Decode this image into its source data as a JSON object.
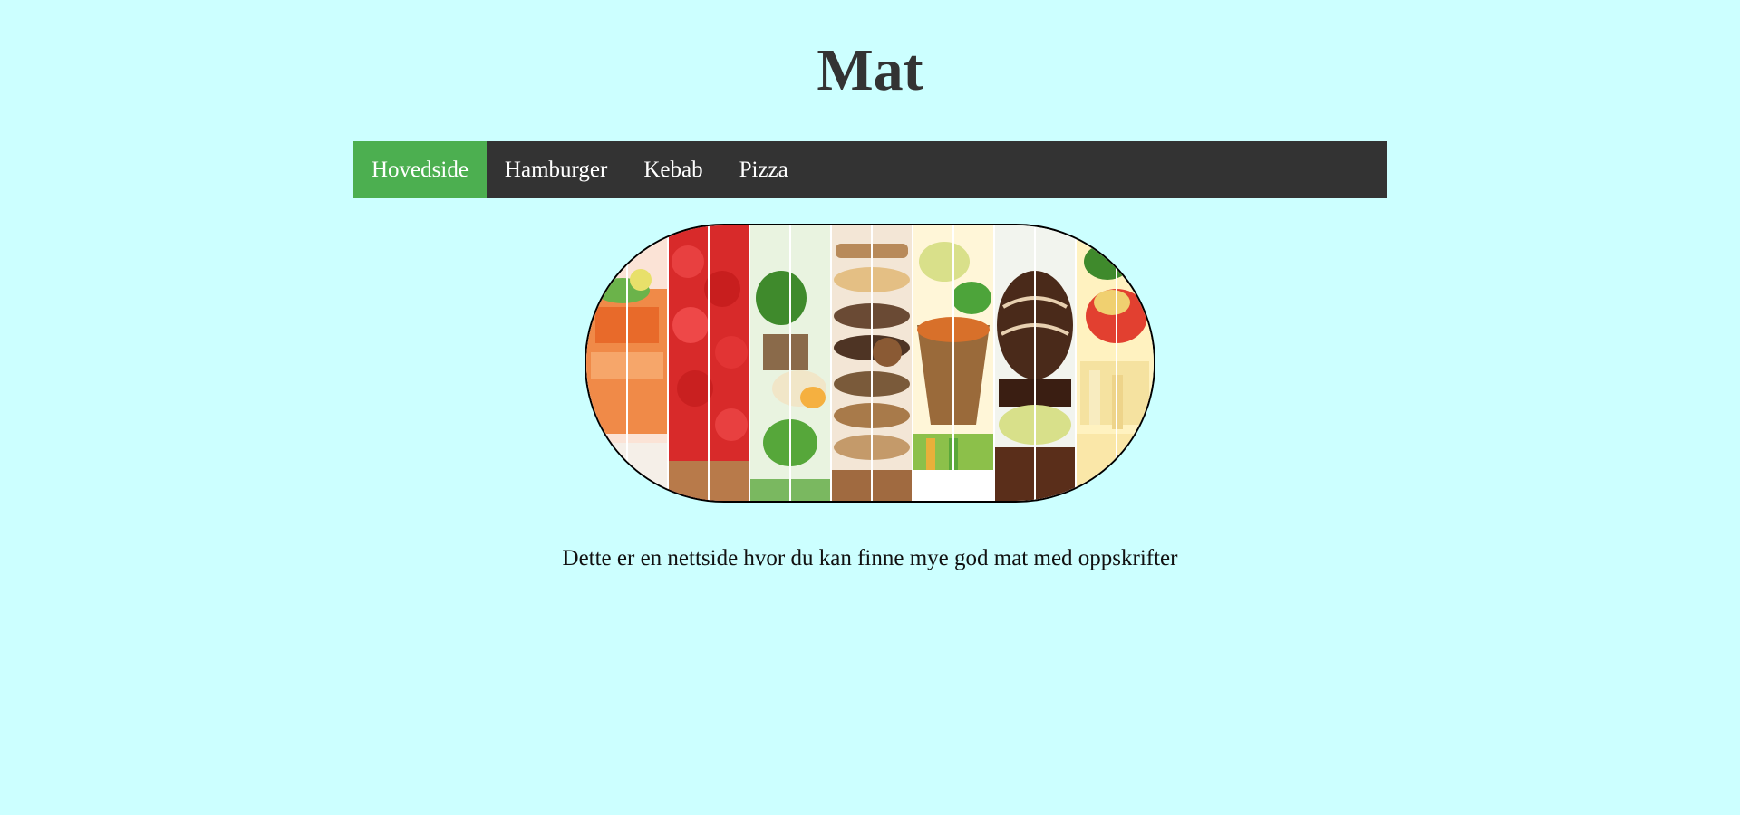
{
  "header": {
    "title": "Mat"
  },
  "nav": {
    "items": [
      {
        "label": "Hovedside",
        "active": true
      },
      {
        "label": "Hamburger",
        "active": false
      },
      {
        "label": "Kebab",
        "active": false
      },
      {
        "label": "Pizza",
        "active": false
      }
    ],
    "active_color": "#4CAF50",
    "bar_color": "#333333"
  },
  "banner": {
    "description": "food-collage-image",
    "panels": [
      "salmon",
      "strawberries",
      "salad",
      "cookies",
      "soup",
      "chocolate-dessert",
      "pasta"
    ]
  },
  "main": {
    "intro_text": "Dette er en nettside hvor du kan finne mye god mat med oppskrifter"
  },
  "colors": {
    "background": "#ccffff",
    "title": "#333333"
  }
}
